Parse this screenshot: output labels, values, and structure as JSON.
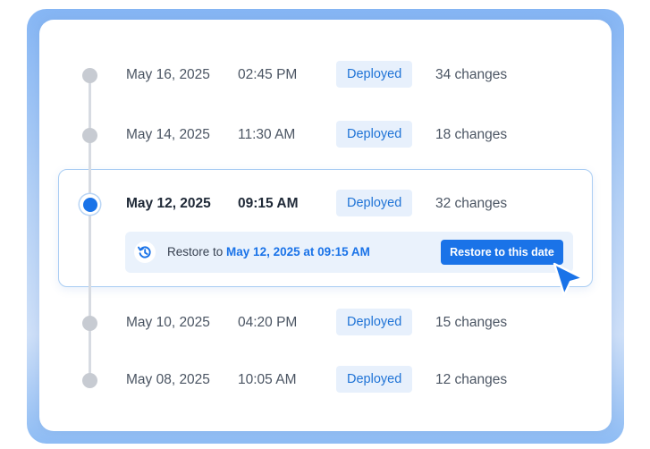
{
  "versions": [
    {
      "date": "May 16, 2025",
      "time": "02:45 PM",
      "status": "Deployed",
      "changes": "34 changes"
    },
    {
      "date": "May 14, 2025",
      "time": "11:30 AM",
      "status": "Deployed",
      "changes": "18 changes"
    },
    {
      "date": "May 12, 2025",
      "time": "09:15 AM",
      "status": "Deployed",
      "changes": "32 changes"
    },
    {
      "date": "May 10, 2025",
      "time": "04:20 PM",
      "status": "Deployed",
      "changes": "15 changes"
    },
    {
      "date": "May 08, 2025",
      "time": "10:05 AM",
      "status": "Deployed",
      "changes": "12 changes"
    }
  ],
  "selected_index": 2,
  "restore": {
    "prefix": "Restore to",
    "target": "May 12, 2025 at 09:15 AM",
    "button_label": "Restore to this date",
    "icon": "history-icon"
  },
  "colors": {
    "accent": "#1a73e8",
    "badge_bg": "#e7f0fc",
    "dot_inactive": "#c7cbd2"
  }
}
